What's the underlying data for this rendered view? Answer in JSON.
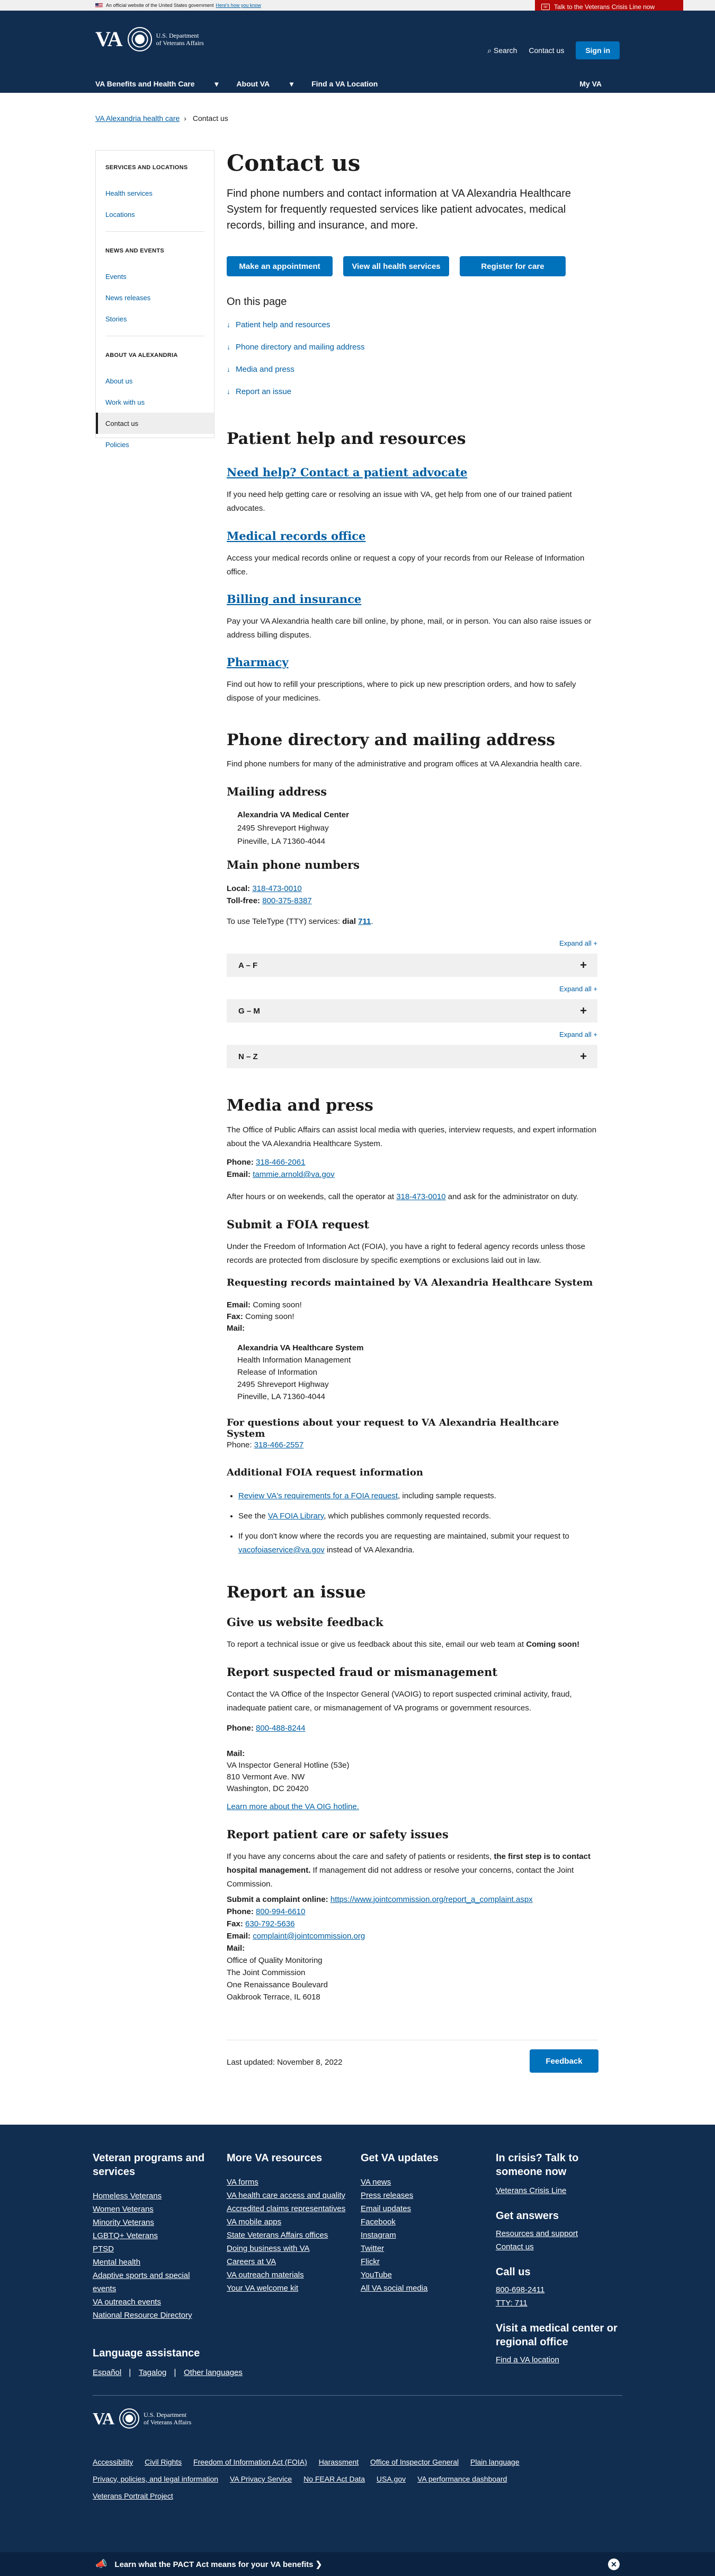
{
  "banner": {
    "text": "An official website of the United States government",
    "how": "Here's how you know",
    "crisis": "Talk to the Veterans Crisis Line now"
  },
  "header": {
    "logo": "VA",
    "dept_line1": "U.S. Department",
    "dept_line2": "of Veterans Affairs",
    "search": "Search",
    "contact": "Contact us",
    "signin": "Sign in",
    "nav": [
      "VA Benefits and Health Care",
      "About VA",
      "Find a VA Location"
    ],
    "myva": "My VA"
  },
  "breadcrumb": [
    "VA Alexandria health care",
    "Contact us"
  ],
  "sidebar": {
    "sections": [
      {
        "title": "SERVICES AND LOCATIONS",
        "items": [
          "Health services",
          "Locations"
        ]
      },
      {
        "title": "NEWS AND EVENTS",
        "items": [
          "Events",
          "News releases",
          "Stories"
        ]
      },
      {
        "title": "ABOUT VA ALEXANDRIA",
        "items": [
          "About us",
          "Work with us",
          "Contact us",
          "Policies"
        ]
      }
    ]
  },
  "main": {
    "title": "Contact us",
    "intro": "Find phone numbers and contact information at VA Alexandria Healthcare System for frequently requested services like patient advocates, medical records, billing and insurance, and more.",
    "buttons": [
      "Make an appointment",
      "View all health services",
      "Register for care"
    ],
    "otp_title": "On this page",
    "otp": [
      "Patient help and resources",
      "Phone directory and mailing address",
      "Media and press",
      "Report an issue"
    ],
    "patient": {
      "title": "Patient help and resources",
      "items": [
        {
          "h": "Need help? Contact a patient advocate",
          "p": "If you need help getting care or resolving an issue with VA, get help from one of our trained patient advocates."
        },
        {
          "h": "Medical records office",
          "p": "Access your medical records online or request a copy of your records from our Release of Information office."
        },
        {
          "h": "Billing and insurance",
          "p": "Pay your VA Alexandria health care bill online, by phone, mail, or in person. You can also raise issues or address billing disputes."
        },
        {
          "h": "Pharmacy",
          "p": "Find out how to refill your prescriptions, where to pick up new prescription orders, and how to safely dispose of your medicines."
        }
      ]
    },
    "phone": {
      "title": "Phone directory and mailing address",
      "p": "Find phone numbers for many of the administrative and program offices at VA Alexandria health care.",
      "mail_title": "Mailing address",
      "addr": [
        "Alexandria VA Medical Center",
        "2495 Shreveport Highway",
        "Pineville, LA 71360-4044"
      ],
      "main_title": "Main phone numbers",
      "local_label": "Local:",
      "local": "318-473-0010",
      "tollfree_label": "Toll-free:",
      "tollfree": "800-375-8387",
      "tty": "To use TeleType (TTY) services:",
      "tty_dial": "dial",
      "tty_num": "711",
      "expand": "Expand all +",
      "acc": [
        "A – F",
        "G – M",
        "N – Z"
      ]
    },
    "media": {
      "title": "Media and press",
      "p": "The Office of Public Affairs can assist local media with queries, interview requests, and expert information about the VA Alexandria Healthcare System.",
      "phone_label": "Phone:",
      "phone": "318-466-2061",
      "email_label": "Email:",
      "email": "tammie.arnold@va.gov",
      "after1": "After hours or on weekends, call the operator at",
      "after_num": "318-473-0010",
      "after2": "and ask for the administrator on duty.",
      "foia_title": "Submit a FOIA request",
      "foia_p": "Under the Freedom of Information Act (FOIA), you have a right to federal agency records unless those records are protected from disclosure by specific exemptions or exclusions laid out in law.",
      "req_title": "Requesting records maintained by VA Alexandria Healthcare System",
      "email_line": "Coming soon!",
      "fax_label": "Fax:",
      "fax_line": "Coming soon!",
      "mail_label": "Mail:",
      "foia_addr": [
        "Alexandria VA Healthcare System",
        "Health Information Management",
        "Release of Information",
        "2495 Shreveport Highway",
        "Pineville, LA 71360-4044"
      ],
      "q_title": "For questions about your request to VA Alexandria Healthcare System",
      "q_phone": "318-466-2557",
      "add_title": "Additional FOIA request information",
      "add1_link": "Review VA's requirements for a FOIA request",
      "add1_rest": ", including sample requests.",
      "add2_pre": "See the",
      "add2_link": "VA FOIA Library",
      "add2_rest": ", which publishes commonly requested records.",
      "add3_pre": "If you don't know where the records you are requesting are maintained, submit your request to",
      "add3_link": "vacofoiaservice@va.gov",
      "add3_rest": "instead of VA Alexandria."
    },
    "report": {
      "title": "Report an issue",
      "web_title": "Give us website feedback",
      "web_p": "To report a technical issue or give us feedback about this site, email our web team at",
      "web_bold": "Coming soon!",
      "fraud_title": "Report suspected fraud or mismanagement",
      "fraud_p": "Contact the VA Office of the Inspector General (VAOIG) to report suspected criminal activity, fraud, inadequate patient care, or mismanagement of VA programs or government resources.",
      "fraud_phone": "800-488-8244",
      "fraud_addr": [
        "VA Inspector General Hotline (53e)",
        "810 Vermont Ave. NW",
        "Washington, DC 20420"
      ],
      "oig_link": "Learn more about the VA OIG hotline.",
      "safety_title": "Report patient care or safety issues",
      "safety_p1": "If you have any concerns about the care and safety of patients or residents,",
      "safety_bold": "the first step is to contact hospital management.",
      "safety_p2": "If management did not address or resolve your concerns, contact the Joint Commission.",
      "complaint_label": "Submit a complaint online:",
      "complaint": "https://www.jointcommission.org/report_a_complaint.aspx",
      "jc_phone": "800-994-6610",
      "jc_fax": "630-792-5636",
      "jc_email": "complaint@jointcommission.org",
      "jc_addr": [
        "Office of Quality Monitoring",
        "The Joint Commission",
        "One Renaissance Boulevard",
        "Oakbrook Terrace, IL 6018"
      ]
    },
    "updated": "Last updated: November 8, 2022",
    "feedback": "Feedback"
  },
  "footer": {
    "c1": {
      "title": "Veteran programs and services",
      "links": [
        "Homeless Veterans",
        "Women Veterans",
        "Minority Veterans",
        "LGBTQ+ Veterans",
        "PTSD",
        "Mental health",
        "Adaptive sports and special events",
        "VA outreach events",
        "National Resource Directory"
      ]
    },
    "c2": {
      "title": "More VA resources",
      "links": [
        "VA forms",
        "VA health care access and quality",
        "Accredited claims representatives",
        "VA mobile apps",
        "State Veterans Affairs offices",
        "Doing business with VA",
        "Careers at VA",
        "VA outreach materials",
        "Your VA welcome kit"
      ]
    },
    "c3": {
      "title": "Get VA updates",
      "links": [
        "VA news",
        "Press releases",
        "Email updates",
        "Facebook",
        "Instagram",
        "Twitter",
        "Flickr",
        "YouTube",
        "All VA social media"
      ]
    },
    "c4": {
      "title": "In crisis? Talk to someone now",
      "crisis_link": "Veterans Crisis Line",
      "answers_title": "Get answers",
      "answers": [
        "Resources and support",
        "Contact us"
      ],
      "call_title": "Call us",
      "call": [
        "800-698-2411",
        "TTY: 711"
      ],
      "visit_title": "Visit a medical center or regional office",
      "visit": "Find a VA location"
    },
    "lang_title": "Language assistance",
    "langs": [
      "Español",
      "Tagalog",
      "Other languages"
    ],
    "links": [
      "Accessibility",
      "Civil Rights",
      "Freedom of Information Act (FOIA)",
      "Harassment",
      "Office of Inspector General",
      "Plain language",
      "Privacy, policies, and legal information",
      "VA Privacy Service",
      "No FEAR Act Data",
      "USA.gov",
      "VA performance dashboard",
      "Veterans Portrait Project"
    ],
    "pact": "Learn what the PACT Act means for your VA benefits ❯"
  }
}
